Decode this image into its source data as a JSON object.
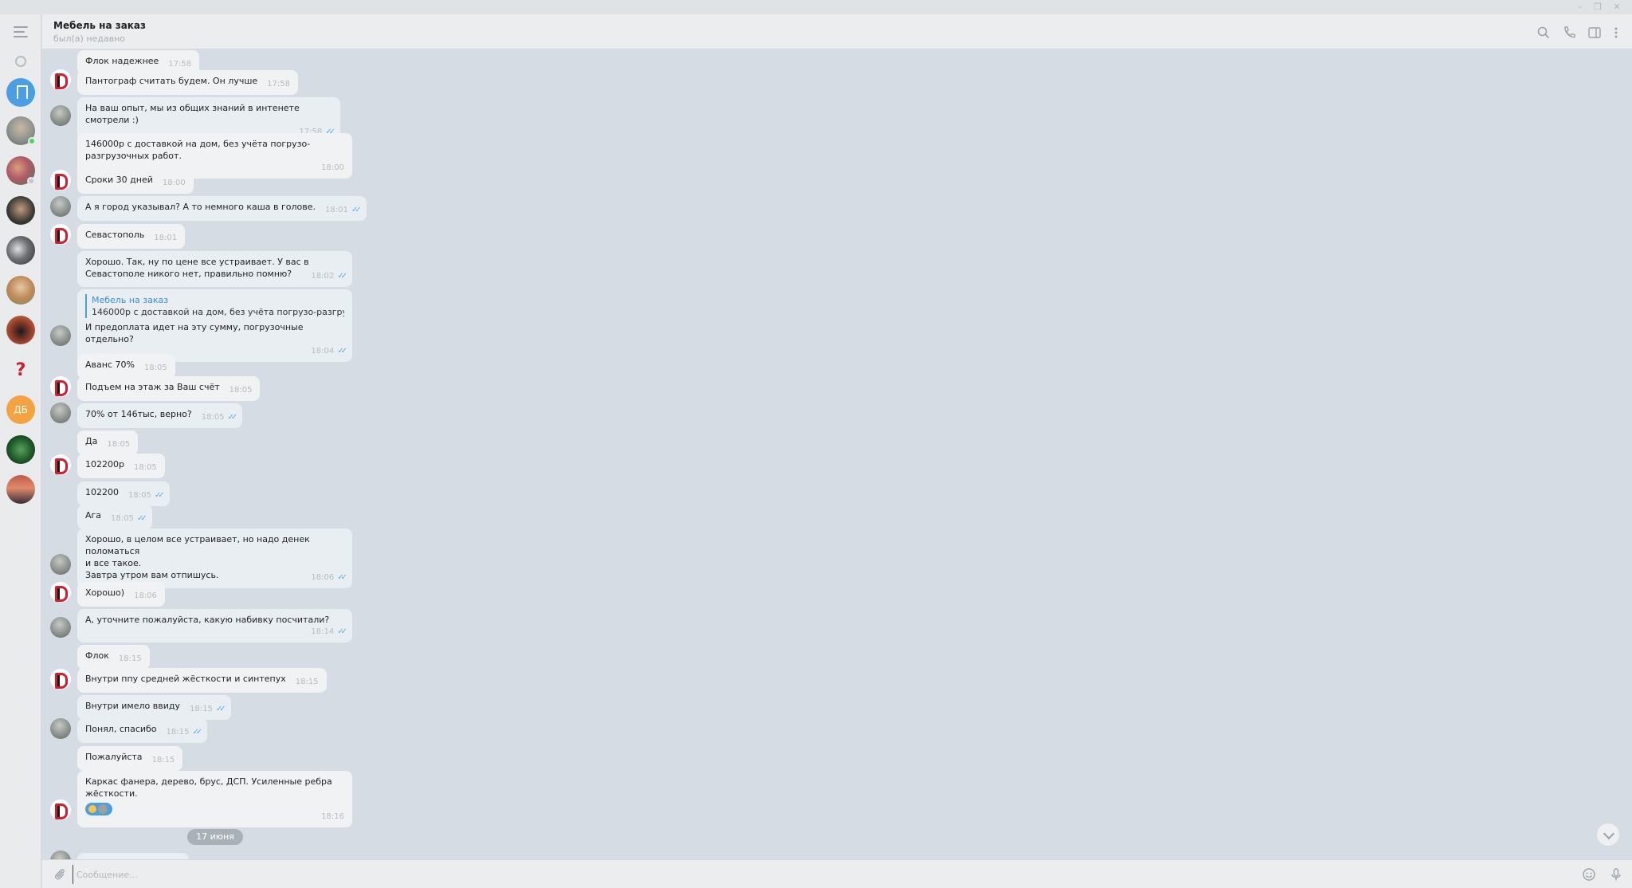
{
  "header": {
    "title": "Мебель на заказ",
    "status": "был(а) недавно"
  },
  "composer": {
    "placeholder": "Сообщение..."
  },
  "date_chip": "17 июня",
  "colors": {
    "accent": "#4a9ee4",
    "online": "#4dd067",
    "brand_red": "#d11f2f"
  },
  "sidebar": {
    "chats": [
      {
        "icon": "saved-messages-icon",
        "color": "#4a9ee4"
      },
      {
        "icon": "avatar",
        "color": "#8a8f8a"
      },
      {
        "icon": "avatar",
        "color": "#b05a6a"
      },
      {
        "icon": "avatar",
        "color": "#3a3a35"
      },
      {
        "icon": "avatar",
        "color": "#6f7175"
      },
      {
        "icon": "avatar",
        "color": "#c08a5a"
      },
      {
        "icon": "avatar",
        "color": "#8a3a2a"
      },
      {
        "icon": "avatar",
        "color": "#e9ebed"
      },
      {
        "icon": "avatar",
        "color": "#f5a340",
        "initials": "ДБ"
      },
      {
        "icon": "avatar",
        "color": "#1f5a2a"
      },
      {
        "icon": "avatar",
        "color": "#c05a4a"
      }
    ]
  },
  "messages": [
    {
      "text": "Флок надежнее",
      "time": "17:58",
      "out": false
    },
    {
      "text": "Пантограф считать будем. Он лучше",
      "time": "17:58",
      "out": false
    },
    {
      "text": "На ваш опыт, мы из общих знаний в интенете смотрели :)",
      "time": "17:58",
      "out": true
    },
    {
      "text": "146000р с доставкой на дом, без учёта погрузо-\nразгрузочных работ.",
      "time": "18:00",
      "out": false
    },
    {
      "text": "Сроки 30 дней",
      "time": "18:00",
      "out": false
    },
    {
      "text": "А я город указывал? А то немного каша в голове.",
      "time": "18:01",
      "out": true
    },
    {
      "text": "Севастополь",
      "time": "18:01",
      "out": false
    },
    {
      "text": "Хорошо. Так, ну по цене все устраивает. У вас в\nСевастополе никого нет, правильно помню?",
      "time": "18:02",
      "out": true
    },
    {
      "quote_name": "Мебель на заказ",
      "quote_text": "146000р с доставкой на дом, без учёта погрузо-разгрузо...",
      "text": "И предоплата идет на эту сумму, погрузочные отдельно?",
      "time": "18:04",
      "out": true
    },
    {
      "text": "Аванс 70%",
      "time": "18:05",
      "out": false
    },
    {
      "text": "Подъем на этаж за Ваш счёт",
      "time": "18:05",
      "out": false
    },
    {
      "text": "70% от 146тыс, верно?",
      "time": "18:05",
      "out": true
    },
    {
      "text": "Да",
      "time": "18:05",
      "out": false
    },
    {
      "text": "102200р",
      "time": "18:05",
      "out": false
    },
    {
      "text": "102200",
      "time": "18:05",
      "out": true
    },
    {
      "text": "Ага",
      "time": "18:05",
      "out": true
    },
    {
      "text": "Хорошо, в целом все устраивает, но надо денек поломаться\nи все такое.\nЗавтра утром вам отпишусь.",
      "time": "18:06",
      "out": true
    },
    {
      "text": "Хорошо)",
      "time": "18:06",
      "out": false
    },
    {
      "text": "А, уточните пожалуйста, какую набивку посчитали?",
      "time": "18:14",
      "out": true
    },
    {
      "text": "Флок",
      "time": "18:15",
      "out": false
    },
    {
      "text": "Внутри ппу средней жёсткости и синтепух",
      "time": "18:15",
      "out": false
    },
    {
      "text": "Внутри имело ввиду",
      "time": "18:15",
      "out": true
    },
    {
      "text": "Понял, спасибо",
      "time": "18:15",
      "out": true
    },
    {
      "text": "Пожалуйста",
      "time": "18:15",
      "out": false
    },
    {
      "text": "Каркас фанера, дерево, брус, ДСП. Усиленные ребра\nжёсткости.",
      "time": "18:16",
      "out": false,
      "reactions": 2
    }
  ]
}
